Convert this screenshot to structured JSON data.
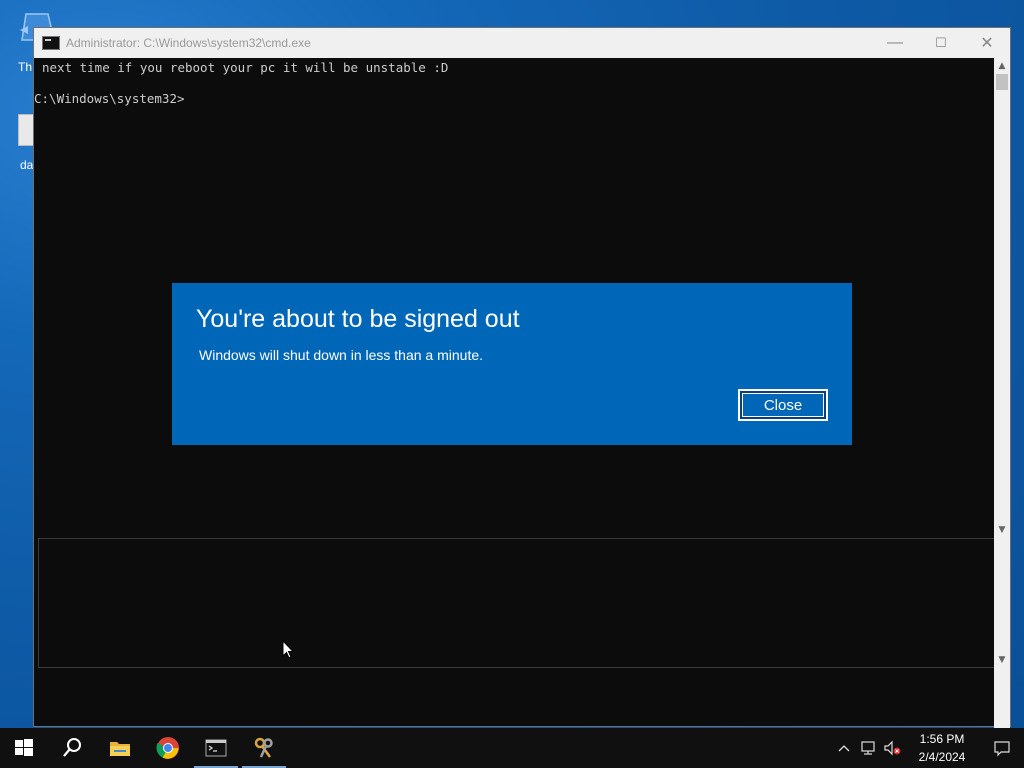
{
  "desktop": {
    "icons": [
      {
        "label": "Th"
      },
      {
        "label": "da"
      }
    ]
  },
  "window": {
    "title": "Administrator: C:\\Windows\\system32\\cmd.exe",
    "minimize": "—",
    "maximize": "☐",
    "close": "✕",
    "console_lines": [
      "next time if you reboot your pc it will be unstable :D",
      "C:\\Windows\\system32>"
    ]
  },
  "dialog": {
    "title": "You're about to be signed out",
    "message": "Windows will shut down in less than a minute.",
    "close_label": "Close"
  },
  "taskbar": {
    "items": [
      "start",
      "search",
      "file-explorer",
      "chrome",
      "cmd",
      "keys-app"
    ],
    "time": "1:56 PM",
    "date": "2/4/2024"
  }
}
